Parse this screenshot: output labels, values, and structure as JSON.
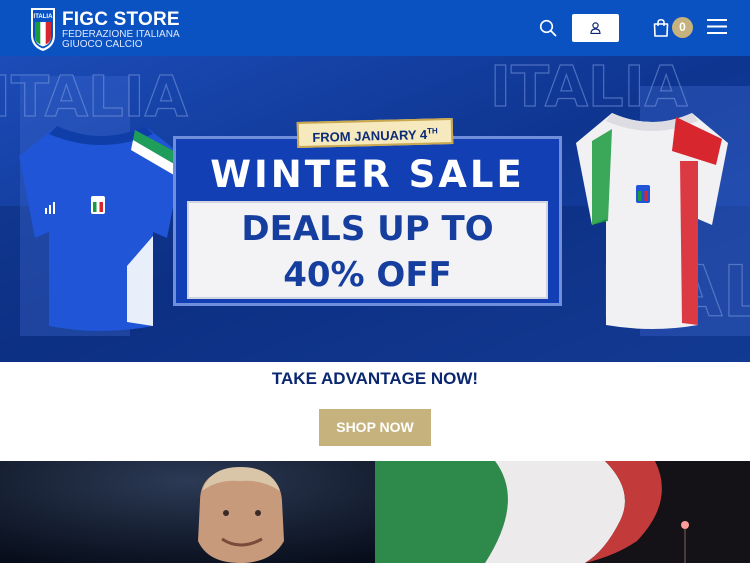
{
  "header": {
    "brand_title": "FIGC STORE",
    "brand_sub_1": "FEDERAZIONE ITALIANA",
    "brand_sub_2": "GIUOCO CALCIO",
    "crest_text": "ITALIA",
    "cart_count": "0",
    "icons": {
      "search": "search-icon",
      "account": "user-icon",
      "cart": "shopping-bag-icon",
      "menu": "hamburger-menu-icon"
    },
    "colors": {
      "bar": "#0a52c2",
      "accent": "#c6b27c"
    }
  },
  "hero": {
    "ribbon_text": "FROM JANUARY 4",
    "ribbon_suffix": "TH",
    "title": "WINTER SALE",
    "deals_line1": "DEALS UP TO",
    "deals_line2": "40% OFF",
    "watermark": "ITALIA"
  },
  "promo": {
    "text": "TAKE ADVANTAGE NOW!",
    "button": "SHOP NOW"
  }
}
